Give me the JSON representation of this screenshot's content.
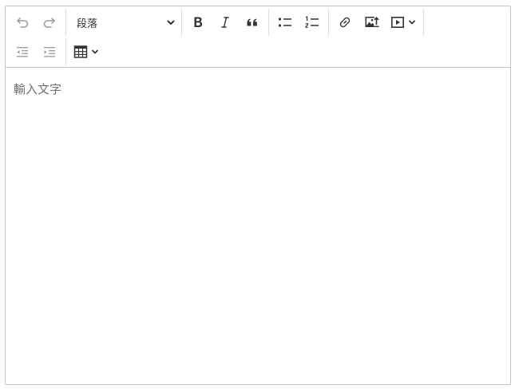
{
  "toolbar": {
    "heading": {
      "selected": "段落"
    },
    "buttons": [
      {
        "name": "undo",
        "icon": "undo-icon",
        "enabled": false
      },
      {
        "name": "redo",
        "icon": "redo-icon",
        "enabled": false
      },
      {
        "name": "bold",
        "icon": "bold-icon",
        "enabled": true
      },
      {
        "name": "italic",
        "icon": "italic-icon",
        "enabled": true
      },
      {
        "name": "block-quote",
        "icon": "quote-icon",
        "enabled": true
      },
      {
        "name": "bulleted-list",
        "icon": "bulleted-list-icon",
        "enabled": true
      },
      {
        "name": "numbered-list",
        "icon": "numbered-list-icon",
        "enabled": true
      },
      {
        "name": "link",
        "icon": "link-icon",
        "enabled": true
      },
      {
        "name": "insert-image",
        "icon": "image-upload-icon",
        "enabled": true
      },
      {
        "name": "insert-media",
        "icon": "media-icon",
        "enabled": true
      },
      {
        "name": "outdent",
        "icon": "outdent-icon",
        "enabled": false
      },
      {
        "name": "indent",
        "icon": "indent-icon",
        "enabled": false
      },
      {
        "name": "insert-table",
        "icon": "table-icon",
        "enabled": true
      }
    ]
  },
  "editor": {
    "placeholder": "輸入文字"
  },
  "colors": {
    "border": "#c4c4c4",
    "separator": "#dedede",
    "icon": "#333333",
    "icon_disabled": "#9a9a9a",
    "placeholder": "#707070"
  }
}
